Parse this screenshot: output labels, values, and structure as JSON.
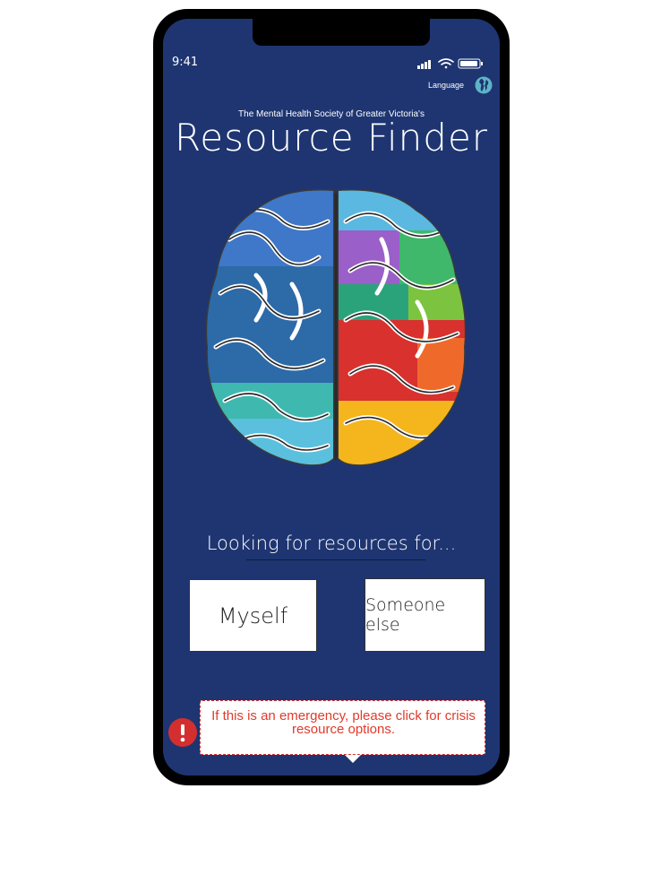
{
  "status_bar": {
    "time": "9:41"
  },
  "header": {
    "language_label": "Language",
    "subtitle": "The Mental Health Society of Greater Victoria's",
    "title": "Resource Finder"
  },
  "main": {
    "prompt": "Looking for resources for...",
    "choices": {
      "myself": "Myself",
      "someone_else": "Someone else"
    }
  },
  "emergency": {
    "tooltip_text": "If this is an emergency, please click for crisis resource options."
  },
  "colors": {
    "background": "#1e3571",
    "accent_alert": "#d32f2f",
    "globe": "#5fb3c7"
  }
}
